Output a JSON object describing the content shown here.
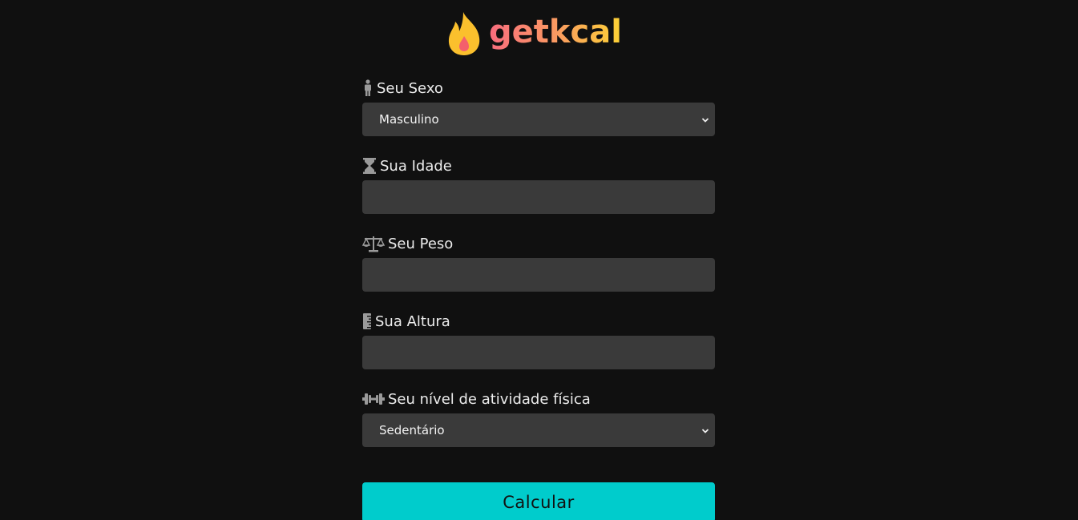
{
  "brand": {
    "name": "getkcal",
    "icon": "fire-icon",
    "gradient": [
      "#f86d7e",
      "#fa9a62",
      "#fcd235"
    ]
  },
  "form": {
    "sex": {
      "label": "Seu Sexo",
      "icon": "person-icon",
      "selected": "Masculino"
    },
    "age": {
      "label": "Sua Idade",
      "icon": "hourglass-icon",
      "value": ""
    },
    "weight": {
      "label": "Seu Peso",
      "icon": "scale-icon",
      "value": ""
    },
    "height": {
      "label": "Sua Altura",
      "icon": "ruler-icon",
      "value": ""
    },
    "activity": {
      "label": "Seu nível de atividade física",
      "icon": "dumbbell-icon",
      "selected": "Sedentário"
    },
    "submit_label": "Calcular"
  },
  "colors": {
    "background": "#101010",
    "field": "#3a3a3a",
    "button": "#00cccc"
  }
}
